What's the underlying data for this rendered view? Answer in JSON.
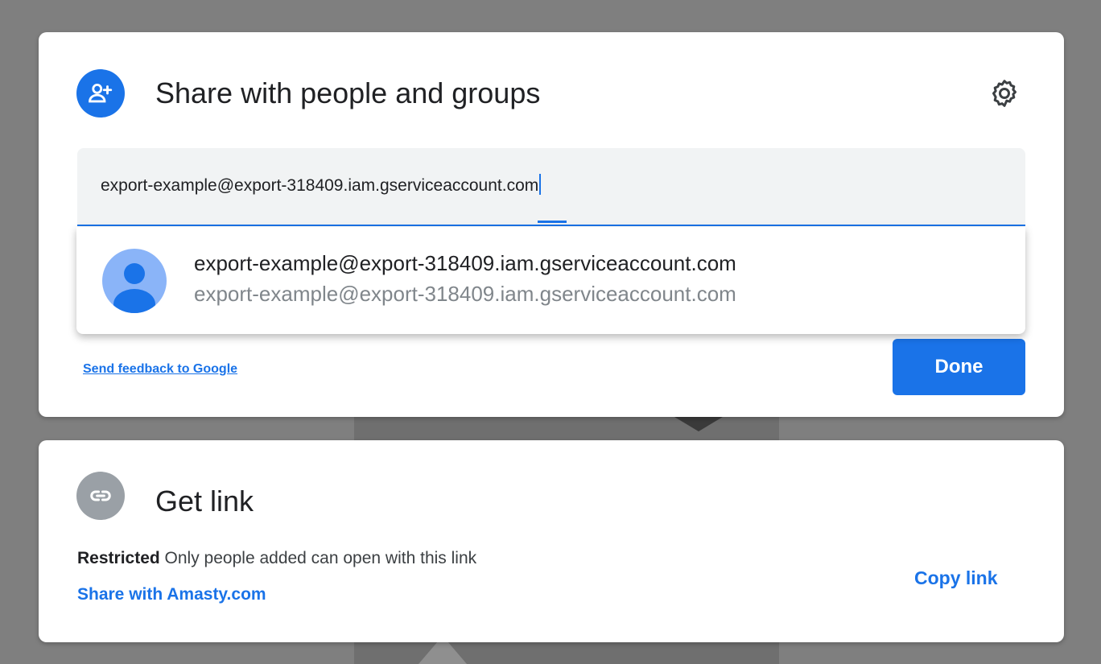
{
  "share_dialog": {
    "title": "Share with people and groups",
    "icon": "person-add-icon",
    "settings_icon": "gear-icon",
    "input": {
      "value": "export-example@export-318409.iam.gserviceaccount.com"
    },
    "suggestion": {
      "name": "export-example@export-318409.iam.gserviceaccount.com",
      "email": "export-example@export-318409.iam.gserviceaccount.com",
      "icon": "avatar-icon"
    },
    "feedback_link": "Send feedback to Google",
    "done_label": "Done"
  },
  "link_dialog": {
    "title": "Get link",
    "icon": "link-icon",
    "restricted_label": "Restricted",
    "restricted_description": "Only people added can open with this link",
    "share_domain_link": "Share with Amasty.com",
    "copy_link_label": "Copy link"
  },
  "colors": {
    "accent": "#1a73e8",
    "backdrop": "#7f7f7f",
    "link_icon_bg": "#9aa0a6"
  }
}
